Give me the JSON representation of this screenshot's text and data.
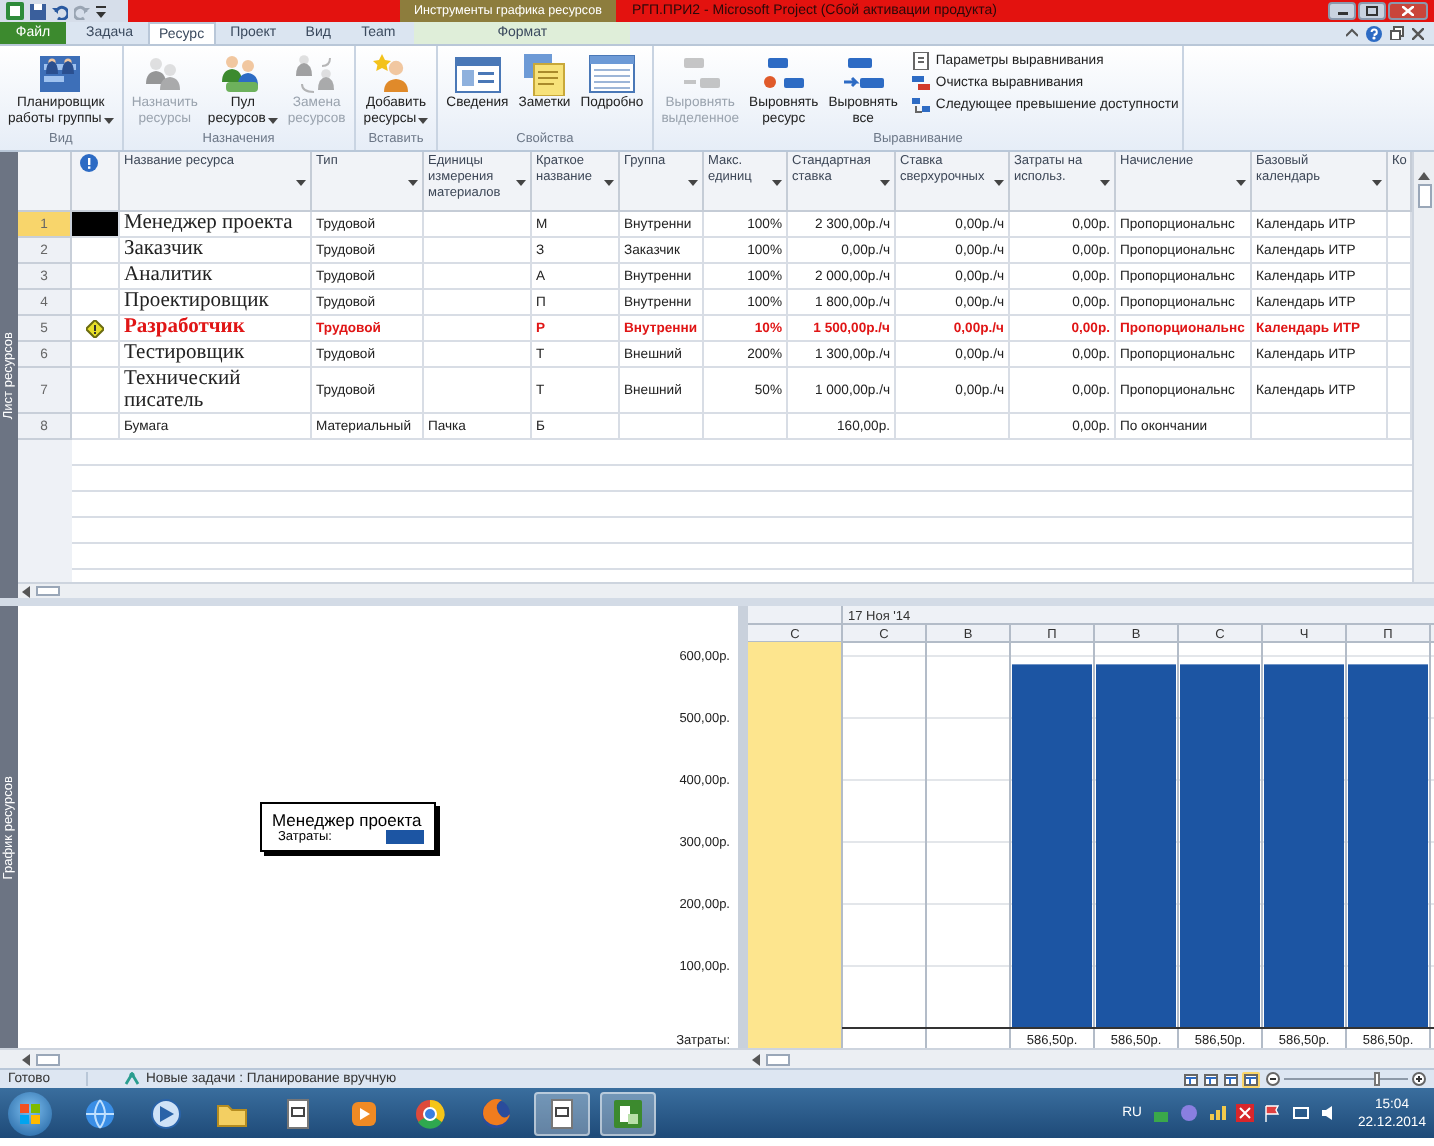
{
  "window": {
    "title": "РГП.ПРИ2 - Microsoft Project (Сбой активации продукта)",
    "context_group": "Инструменты графика ресурсов"
  },
  "tabs": [
    {
      "label": "Файл",
      "kind": "file",
      "selected": false
    },
    {
      "label": "Задача",
      "kind": "normal",
      "selected": false
    },
    {
      "label": "Ресурс",
      "kind": "normal",
      "selected": true
    },
    {
      "label": "Проект",
      "kind": "normal",
      "selected": false
    },
    {
      "label": "Вид",
      "kind": "normal",
      "selected": false
    },
    {
      "label": "Team",
      "kind": "normal",
      "selected": false
    },
    {
      "label": "Формат",
      "kind": "context",
      "selected": false
    }
  ],
  "ribbon_groups": [
    {
      "label": "Вид",
      "buttons": [
        {
          "kind": "team",
          "lines": [
            "Планировщик",
            "работы группы"
          ],
          "dropdown": true,
          "disabled": false
        }
      ]
    },
    {
      "label": "Назначения",
      "buttons": [
        {
          "kind": "assign",
          "lines": [
            "Назначить",
            "ресурсы"
          ],
          "dropdown": false,
          "disabled": true
        },
        {
          "kind": "pool",
          "lines": [
            "Пул",
            "ресурсов"
          ],
          "dropdown": true,
          "disabled": false
        },
        {
          "kind": "replace",
          "lines": [
            "Замена",
            "ресурсов"
          ],
          "dropdown": false,
          "disabled": true
        }
      ]
    },
    {
      "label": "Вставить",
      "buttons": [
        {
          "kind": "add",
          "lines": [
            "Добавить",
            "ресурсы"
          ],
          "dropdown": true,
          "disabled": false
        }
      ]
    },
    {
      "label": "Свойства",
      "buttons": [
        {
          "kind": "info",
          "lines": [
            "Сведения"
          ],
          "dropdown": false,
          "disabled": false
        },
        {
          "kind": "notes",
          "lines": [
            "Заметки"
          ],
          "dropdown": false,
          "disabled": false
        },
        {
          "kind": "details",
          "lines": [
            "Подробно"
          ],
          "dropdown": false,
          "disabled": false
        }
      ]
    },
    {
      "label": "Выравнивание",
      "buttons": [
        {
          "kind": "level_selection",
          "lines": [
            "Выровнять",
            "выделенное"
          ],
          "dropdown": false,
          "disabled": true
        },
        {
          "kind": "level_resource",
          "lines": [
            "Выровнять",
            "ресурс"
          ],
          "dropdown": false,
          "disabled": false
        },
        {
          "kind": "level_all",
          "lines": [
            "Выровнять",
            "все"
          ],
          "dropdown": false,
          "disabled": false
        }
      ],
      "small_buttons": [
        {
          "kind": "options",
          "label": "Параметры выравнивания"
        },
        {
          "kind": "clear",
          "label": "Очистка выравнивания"
        },
        {
          "kind": "next",
          "label": "Следующее превышение доступности"
        }
      ]
    }
  ],
  "sheet": {
    "side_label": "Лист ресурсов",
    "columns": [
      {
        "label": "Название ресурса",
        "dropdown": true
      },
      {
        "label": "Тип",
        "dropdown": true
      },
      {
        "label": "Единицы измерения материалов",
        "dropdown": true
      },
      {
        "label": "Краткое название",
        "dropdown": true
      },
      {
        "label": "Группа",
        "dropdown": true
      },
      {
        "label": "Макс. единиц",
        "dropdown": true
      },
      {
        "label": "Стандартная ставка",
        "dropdown": true
      },
      {
        "label": "Ставка сверхурочных",
        "dropdown": true
      },
      {
        "label": "Затраты на использ.",
        "dropdown": true
      },
      {
        "label": "Начисление",
        "dropdown": true
      },
      {
        "label": "Базовый календарь",
        "dropdown": true
      },
      {
        "label": "Ко",
        "dropdown": false
      }
    ],
    "rows": [
      {
        "id": "1",
        "kind": "work",
        "selected": true,
        "overallocated": false,
        "cells": [
          "Менеджер проекта",
          "Трудовой",
          null,
          "М",
          "Внутренни",
          "100%",
          "2 300,00р./ч",
          "0,00р./ч",
          "0,00р.",
          "Пропорциональнс",
          "Календарь ИТР"
        ]
      },
      {
        "id": "2",
        "kind": "work",
        "selected": false,
        "overallocated": false,
        "cells": [
          "Заказчик",
          "Трудовой",
          null,
          "З",
          "Заказчик",
          "100%",
          "0,00р./ч",
          "0,00р./ч",
          "0,00р.",
          "Пропорциональнс",
          "Календарь ИТР"
        ]
      },
      {
        "id": "3",
        "kind": "work",
        "selected": false,
        "overallocated": false,
        "cells": [
          "Аналитик",
          "Трудовой",
          null,
          "А",
          "Внутренни",
          "100%",
          "2 000,00р./ч",
          "0,00р./ч",
          "0,00р.",
          "Пропорциональнс",
          "Календарь ИТР"
        ]
      },
      {
        "id": "4",
        "kind": "work",
        "selected": false,
        "overallocated": false,
        "cells": [
          "Проектировщик",
          "Трудовой",
          null,
          "П",
          "Внутренни",
          "100%",
          "1 800,00р./ч",
          "0,00р./ч",
          "0,00р.",
          "Пропорциональнс",
          "Календарь ИТР"
        ]
      },
      {
        "id": "5",
        "kind": "work",
        "selected": false,
        "overallocated": true,
        "cells": [
          "Разработчик",
          "Трудовой",
          null,
          "Р",
          "Внутренни",
          "10%",
          "1 500,00р./ч",
          "0,00р./ч",
          "0,00р.",
          "Пропорциональнс",
          "Календарь ИТР"
        ]
      },
      {
        "id": "6",
        "kind": "work",
        "selected": false,
        "overallocated": false,
        "cells": [
          "Тестировщик",
          "Трудовой",
          null,
          "Т",
          "Внешний",
          "200%",
          "1 300,00р./ч",
          "0,00р./ч",
          "0,00р.",
          "Пропорциональнс",
          "Календарь ИТР"
        ]
      },
      {
        "id": "7",
        "kind": "work",
        "selected": false,
        "overallocated": false,
        "cells": [
          "Технический писатель",
          "Трудовой",
          null,
          "Т",
          "Внешний",
          "50%",
          "1 000,00р./ч",
          "0,00р./ч",
          "0,00р.",
          "Пропорциональнс",
          "Календарь ИТР"
        ]
      },
      {
        "id": "8",
        "kind": "material",
        "selected": false,
        "overallocated": false,
        "cells": [
          "Бумага",
          "Материальный",
          "Пачка",
          "Б",
          null,
          null,
          "160,00р.",
          null,
          "0,00р.",
          "По окончании",
          null
        ]
      }
    ]
  },
  "graph": {
    "side_label": "График ресурсов",
    "legend": {
      "title": "Менеджер проекта",
      "label": "Затраты:"
    },
    "week_label": "17 Ноя '14",
    "totals_label": "Затраты:",
    "day_columns": [
      {
        "highlighted": true
      },
      {
        "highlighted": false
      },
      {
        "highlighted": false
      },
      {
        "highlighted": false
      },
      {
        "highlighted": false
      },
      {
        "highlighted": false
      },
      {
        "highlighted": false
      },
      {
        "highlighted": false
      }
    ],
    "chart_data": {
      "type": "bar",
      "categories": [
        "С",
        "С",
        "В",
        "П",
        "В",
        "С",
        "Ч",
        "П"
      ],
      "series": [
        {
          "color": "#1c55a3",
          "values": [
            null,
            null,
            null,
            586.5,
            586.5,
            586.5,
            586.5,
            586.5
          ]
        }
      ],
      "ylim": [
        0,
        600
      ],
      "grid": true,
      "yticks": [
        {
          "value": 100,
          "label": "100,00р."
        },
        {
          "value": 200,
          "label": "200,00р."
        },
        {
          "value": 300,
          "label": "300,00р."
        },
        {
          "value": 400,
          "label": "400,00р."
        },
        {
          "value": 500,
          "label": "500,00р."
        },
        {
          "value": 600,
          "label": "600,00р."
        }
      ],
      "value_labels": [
        null,
        null,
        null,
        "586,50р.",
        "586,50р.",
        "586,50р.",
        "586,50р.",
        "586,50р."
      ]
    }
  },
  "status_bar": {
    "ready": "Готово",
    "task_mode": "Новые задачи : Планирование вручную",
    "views": [
      {
        "selected": false
      },
      {
        "selected": false
      },
      {
        "selected": false
      },
      {
        "selected": true
      }
    ],
    "zoom": {
      "level": 0.75
    }
  },
  "taskbar": {
    "apps": [
      {
        "kind": "globe",
        "active": false
      },
      {
        "kind": "media",
        "active": false
      },
      {
        "kind": "folder",
        "active": false
      },
      {
        "kind": "document",
        "active": false
      },
      {
        "kind": "play",
        "active": false
      },
      {
        "kind": "wheel",
        "active": false
      },
      {
        "kind": "flame",
        "active": false
      },
      {
        "kind": "document",
        "active": true
      },
      {
        "kind": "project",
        "active": true
      }
    ],
    "language": "RU",
    "time": "15:04",
    "date": "22.12.2014"
  }
}
